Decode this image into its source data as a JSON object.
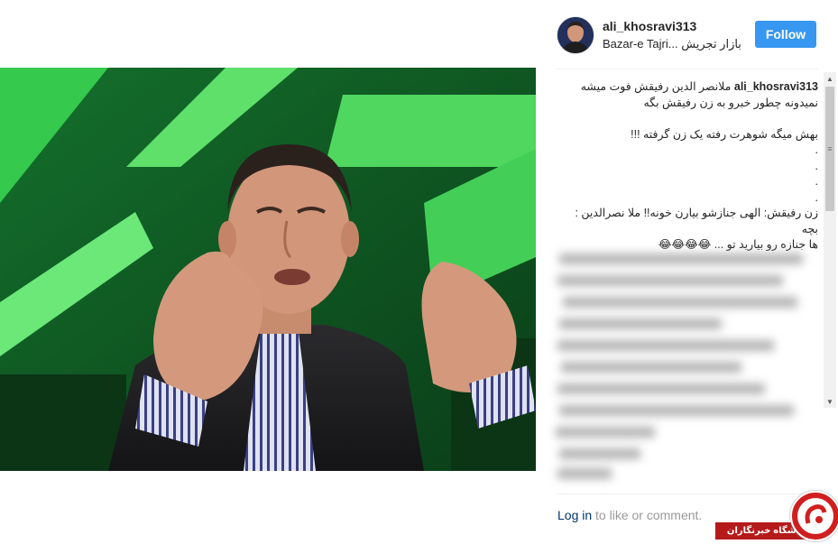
{
  "post": {
    "username": "ali_khosravi313",
    "location": "Bazar-e Tajri... بازار تجریش",
    "follow_label": "Follow"
  },
  "caption": {
    "username": "ali_khosravi313",
    "lines": [
      "ملانصر الدین رفیقش فوت میشه",
      "نمیدونه چطور خبرو به زن رفیقش بگه",
      "",
      "بهش میگه شوهرت رفته یک زن گرفته !!!",
      ".",
      ".",
      ".",
      ".",
      "زن رفیقش: الهی جنازشو بیارن خونه!! ملا نصرالدین : بچه",
      "ها جنازه رو بیارید تو ... 😂😂😂😂"
    ]
  },
  "footer": {
    "login_link": "Log in",
    "login_rest": " to like or comment."
  },
  "watermark": {
    "text": "باشگاه خبرنگاران"
  },
  "icons": {
    "scroll_up": "scroll-up-arrow",
    "scroll_down": "scroll-down-arrow",
    "thumb_grip": "grip"
  }
}
